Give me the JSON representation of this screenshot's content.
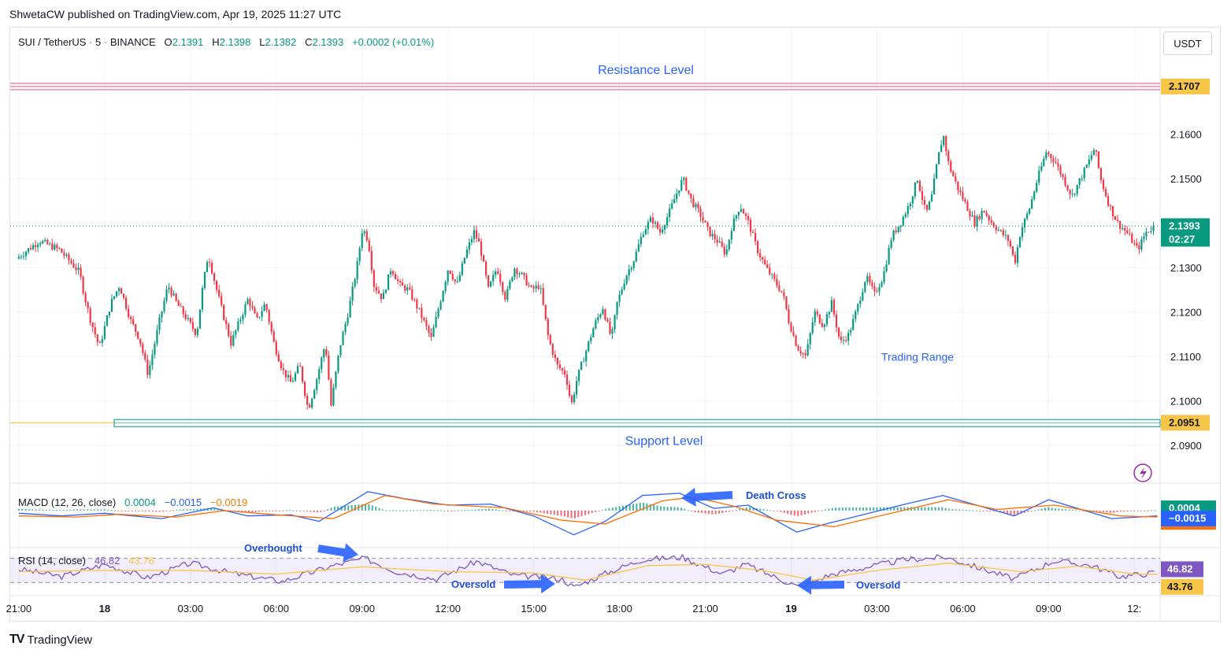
{
  "publisher": "ShwetaCW published on TradingView.com, Apr 19, 2025 11:27 UTC",
  "symbol": {
    "pair": "SUI / TetherUS",
    "interval": "5",
    "exchange": "BINANCE",
    "open_label": "O",
    "open": "2.1391",
    "high_label": "H",
    "high": "2.1398",
    "low_label": "L",
    "low": "2.1382",
    "close_label": "C",
    "close": "2.1393",
    "change": "+0.0002 (+0.01%)"
  },
  "currency": "USDT",
  "logo_text": "TradingView",
  "colors": {
    "up": "#089981",
    "down": "#f23645",
    "resistance": "#f06292",
    "support": "#26a69a",
    "annotation": "#2962ff",
    "macd_line": "#2962ff",
    "signal_line": "#ff6d00",
    "rsi_line": "#7e57c2",
    "rsi_ma": "#f7c547"
  },
  "chart_data": [
    {
      "type": "candlestick",
      "title": "SUI / TetherUS · 5 · BINANCE",
      "ylim": [
        2.084,
        2.176
      ],
      "y_ticks": [
        "2.1600",
        "2.1500",
        "2.1300",
        "2.1200",
        "2.1100",
        "2.1000",
        "2.0900"
      ],
      "y_tick_values": [
        2.16,
        2.15,
        2.13,
        2.12,
        2.11,
        2.1,
        2.09
      ],
      "x_ticks": [
        "21:00",
        "18",
        "03:00",
        "06:00",
        "09:00",
        "12:00",
        "15:00",
        "18:00",
        "21:00",
        "19",
        "03:00",
        "06:00",
        "09:00",
        "12:"
      ],
      "x_tick_hours": [
        0,
        3,
        6,
        9,
        12,
        15,
        18,
        21,
        24,
        27,
        30,
        33,
        36,
        39,
        42
      ],
      "x_range_hours": [
        -0.3,
        39.9
      ],
      "price_path": [
        [
          0.0,
          2.132
        ],
        [
          0.8,
          2.136
        ],
        [
          1.5,
          2.134
        ],
        [
          2.2,
          2.129
        ],
        [
          2.4,
          2.123
        ],
        [
          2.6,
          2.118
        ],
        [
          2.9,
          2.112
        ],
        [
          3.3,
          2.122
        ],
        [
          3.6,
          2.126
        ],
        [
          4.0,
          2.118
        ],
        [
          4.3,
          2.114
        ],
        [
          4.6,
          2.106
        ],
        [
          5.0,
          2.118
        ],
        [
          5.3,
          2.126
        ],
        [
          5.6,
          2.122
        ],
        [
          6.0,
          2.118
        ],
        [
          6.3,
          2.115
        ],
        [
          6.5,
          2.125
        ],
        [
          6.7,
          2.133
        ],
        [
          7.0,
          2.125
        ],
        [
          7.2,
          2.12
        ],
        [
          7.5,
          2.113
        ],
        [
          7.8,
          2.118
        ],
        [
          8.1,
          2.123
        ],
        [
          8.4,
          2.118
        ],
        [
          8.7,
          2.122
        ],
        [
          9.0,
          2.113
        ],
        [
          9.3,
          2.107
        ],
        [
          9.6,
          2.104
        ],
        [
          9.9,
          2.108
        ],
        [
          10.2,
          2.098
        ],
        [
          10.5,
          2.105
        ],
        [
          10.8,
          2.113
        ],
        [
          11.0,
          2.099
        ],
        [
          11.3,
          2.112
        ],
        [
          11.6,
          2.12
        ],
        [
          11.9,
          2.13
        ],
        [
          12.1,
          2.139
        ],
        [
          12.3,
          2.136
        ],
        [
          12.5,
          2.126
        ],
        [
          12.8,
          2.123
        ],
        [
          13.1,
          2.13
        ],
        [
          13.4,
          2.126
        ],
        [
          13.7,
          2.125
        ],
        [
          14.1,
          2.12
        ],
        [
          14.5,
          2.114
        ],
        [
          14.8,
          2.122
        ],
        [
          15.1,
          2.13
        ],
        [
          15.4,
          2.126
        ],
        [
          15.7,
          2.133
        ],
        [
          16.0,
          2.138
        ],
        [
          16.2,
          2.135
        ],
        [
          16.5,
          2.125
        ],
        [
          16.8,
          2.13
        ],
        [
          17.1,
          2.123
        ],
        [
          17.4,
          2.13
        ],
        [
          17.7,
          2.128
        ],
        [
          18.0,
          2.125
        ],
        [
          18.3,
          2.126
        ],
        [
          18.6,
          2.114
        ],
        [
          18.9,
          2.108
        ],
        [
          19.2,
          2.106
        ],
        [
          19.4,
          2.099
        ],
        [
          19.6,
          2.105
        ],
        [
          19.9,
          2.111
        ],
        [
          20.2,
          2.117
        ],
        [
          20.5,
          2.121
        ],
        [
          20.8,
          2.114
        ],
        [
          21.0,
          2.122
        ],
        [
          21.3,
          2.128
        ],
        [
          21.6,
          2.132
        ],
        [
          21.9,
          2.138
        ],
        [
          22.2,
          2.141
        ],
        [
          22.5,
          2.138
        ],
        [
          22.8,
          2.142
        ],
        [
          23.1,
          2.147
        ],
        [
          23.3,
          2.15
        ],
        [
          23.6,
          2.145
        ],
        [
          23.9,
          2.142
        ],
        [
          24.2,
          2.138
        ],
        [
          24.5,
          2.136
        ],
        [
          24.8,
          2.133
        ],
        [
          25.0,
          2.139
        ],
        [
          25.3,
          2.144
        ],
        [
          25.6,
          2.14
        ],
        [
          25.9,
          2.134
        ],
        [
          26.2,
          2.13
        ],
        [
          26.5,
          2.127
        ],
        [
          26.8,
          2.124
        ],
        [
          27.0,
          2.118
        ],
        [
          27.3,
          2.112
        ],
        [
          27.6,
          2.11
        ],
        [
          27.9,
          2.12
        ],
        [
          28.2,
          2.117
        ],
        [
          28.5,
          2.122
        ],
        [
          28.8,
          2.113
        ],
        [
          29.1,
          2.115
        ],
        [
          29.4,
          2.121
        ],
        [
          29.7,
          2.128
        ],
        [
          30.0,
          2.124
        ],
        [
          30.3,
          2.128
        ],
        [
          30.6,
          2.137
        ],
        [
          30.9,
          2.14
        ],
        [
          31.2,
          2.144
        ],
        [
          31.5,
          2.15
        ],
        [
          31.8,
          2.142
        ],
        [
          32.0,
          2.146
        ],
        [
          32.2,
          2.154
        ],
        [
          32.4,
          2.16
        ],
        [
          32.6,
          2.153
        ],
        [
          32.9,
          2.148
        ],
        [
          33.2,
          2.144
        ],
        [
          33.5,
          2.14
        ],
        [
          33.8,
          2.143
        ],
        [
          34.1,
          2.14
        ],
        [
          34.4,
          2.138
        ],
        [
          34.7,
          2.136
        ],
        [
          34.9,
          2.131
        ],
        [
          35.1,
          2.138
        ],
        [
          35.4,
          2.143
        ],
        [
          35.7,
          2.15
        ],
        [
          36.0,
          2.156
        ],
        [
          36.3,
          2.154
        ],
        [
          36.6,
          2.15
        ],
        [
          36.9,
          2.146
        ],
        [
          37.2,
          2.15
        ],
        [
          37.5,
          2.154
        ],
        [
          37.7,
          2.157
        ],
        [
          37.9,
          2.15
        ],
        [
          38.2,
          2.144
        ],
        [
          38.5,
          2.14
        ],
        [
          38.8,
          2.138
        ],
        [
          39.0,
          2.136
        ],
        [
          39.2,
          2.134
        ],
        [
          39.5,
          2.138
        ],
        [
          39.8,
          2.1393
        ]
      ],
      "levels": [
        {
          "label": "2.1707",
          "value": 2.1707,
          "text": "Resistance Level"
        },
        {
          "label": "2.0951",
          "value": 2.0951,
          "text": "Support Level"
        }
      ],
      "current_price": "2.1393",
      "current_price_value": 2.1393,
      "countdown": "02:27",
      "annotations": {
        "range": "Trading Range"
      }
    },
    {
      "type": "line",
      "title": "MACD (12, 26, close)",
      "values_label": [
        "0.0004",
        "−0.0015",
        "−0.0019"
      ],
      "ylim": [
        -0.006,
        0.0045
      ],
      "series": [
        {
          "name": "MACD",
          "points": [
            [
              0,
              -0.0005
            ],
            [
              1.5,
              -0.001
            ],
            [
              3,
              -0.0005
            ],
            [
              5,
              -0.0015
            ],
            [
              6.8,
              0.0005
            ],
            [
              8,
              -0.001
            ],
            [
              9.5,
              -0.0008
            ],
            [
              10.5,
              -0.002
            ],
            [
              12.2,
              0.0035
            ],
            [
              13.5,
              0.0022
            ],
            [
              15,
              0.001
            ],
            [
              16.5,
              0.0012
            ],
            [
              18,
              -0.001
            ],
            [
              19.4,
              -0.0045
            ],
            [
              20.5,
              -0.002
            ],
            [
              21.8,
              0.0028
            ],
            [
              23.1,
              0.0032
            ],
            [
              24.3,
              0.0004
            ],
            [
              25.5,
              0.001
            ],
            [
              27.2,
              -0.004
            ],
            [
              28.2,
              -0.0025
            ],
            [
              29.5,
              -0.0008
            ],
            [
              31,
              0.0012
            ],
            [
              32.3,
              0.0028
            ],
            [
              34.8,
              -0.001
            ],
            [
              36,
              0.002
            ],
            [
              38.2,
              -0.0015
            ],
            [
              39.8,
              -0.001
            ]
          ]
        },
        {
          "name": "Signal",
          "points": [
            [
              0,
              -0.001
            ],
            [
              2,
              -0.0012
            ],
            [
              3.5,
              -0.0007
            ],
            [
              5.5,
              -0.0012
            ],
            [
              7.2,
              0.0
            ],
            [
              9,
              -0.0008
            ],
            [
              11,
              -0.0015
            ],
            [
              12.8,
              0.0028
            ],
            [
              14.5,
              0.0012
            ],
            [
              17,
              0.0005
            ],
            [
              19,
              -0.0018
            ],
            [
              20.5,
              -0.0025
            ],
            [
              22.5,
              0.0018
            ],
            [
              23.6,
              0.0025
            ],
            [
              25,
              0.0008
            ],
            [
              26.5,
              -0.0018
            ],
            [
              28.5,
              -0.003
            ],
            [
              30.5,
              -0.0005
            ],
            [
              32.5,
              0.002
            ],
            [
              34.2,
              0.0002
            ],
            [
              36.2,
              0.001
            ],
            [
              38.5,
              -0.001
            ],
            [
              39.8,
              -0.0012
            ]
          ]
        }
      ]
    },
    {
      "type": "line",
      "title": "RSI (14, close)",
      "values_label": [
        "46.82",
        "43.76"
      ],
      "ylim": [
        15,
        85
      ],
      "bands": [
        70,
        30
      ],
      "series": [
        {
          "name": "RSI",
          "points": [
            [
              0,
              52
            ],
            [
              1.5,
              40
            ],
            [
              3,
              60
            ],
            [
              4.5,
              38
            ],
            [
              6,
              62
            ],
            [
              7.5,
              45
            ],
            [
              9.2,
              32
            ],
            [
              11,
              58
            ],
            [
              12.1,
              70
            ],
            [
              13.2,
              48
            ],
            [
              14.6,
              36
            ],
            [
              16,
              65
            ],
            [
              17.3,
              42
            ],
            [
              19,
              36
            ],
            [
              19.4,
              22
            ],
            [
              20.5,
              45
            ],
            [
              21.8,
              68
            ],
            [
              23.2,
              72
            ],
            [
              24.6,
              44
            ],
            [
              25.4,
              60
            ],
            [
              27.3,
              22
            ],
            [
              28.3,
              42
            ],
            [
              29.6,
              55
            ],
            [
              31,
              68
            ],
            [
              32.4,
              72
            ],
            [
              34.8,
              36
            ],
            [
              36.2,
              66
            ],
            [
              37.5,
              58
            ],
            [
              38.5,
              40
            ],
            [
              39.8,
              46.82
            ]
          ]
        },
        {
          "name": "RSI MA",
          "points": [
            [
              0,
              48
            ],
            [
              3,
              50
            ],
            [
              6,
              50
            ],
            [
              9,
              44
            ],
            [
              12,
              56
            ],
            [
              15,
              48
            ],
            [
              18,
              46
            ],
            [
              19.8,
              34
            ],
            [
              22,
              58
            ],
            [
              24,
              60
            ],
            [
              26,
              50
            ],
            [
              27.8,
              34
            ],
            [
              30,
              50
            ],
            [
              32.5,
              62
            ],
            [
              35,
              48
            ],
            [
              37,
              57
            ],
            [
              39,
              44
            ],
            [
              39.8,
              43.76
            ]
          ]
        }
      ],
      "annotations": {
        "overbought": "Overbought",
        "oversold": "Oversold",
        "oversold_2": "Oversold",
        "death_cross": "Death Cross"
      }
    }
  ]
}
